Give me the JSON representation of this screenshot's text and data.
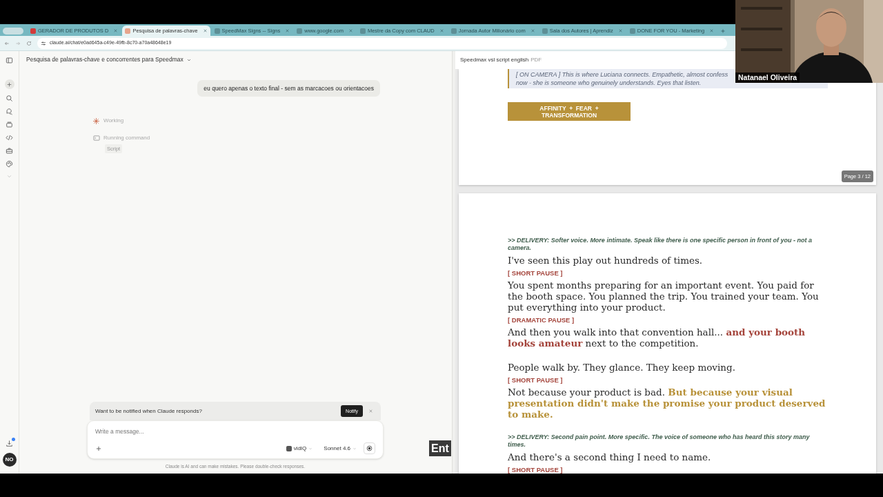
{
  "browser": {
    "tabs": [
      {
        "label": "GERADOR DE PRODUTOS D",
        "selected": false
      },
      {
        "label": "Pesquisa de palavras-chave",
        "selected": true
      },
      {
        "label": "SpeedMax Signs -- Signs",
        "selected": false
      },
      {
        "label": "www.google.com",
        "selected": false
      },
      {
        "label": "Mestre da Copy com CLAUD",
        "selected": false
      },
      {
        "label": "Jornada Autor Milionário com",
        "selected": false
      },
      {
        "label": "Sala dos Autores | Aprendiz",
        "selected": false
      },
      {
        "label": "DONE FOR YOU - Marketing",
        "selected": false
      }
    ],
    "address": "claude.ai/chat/e0ad645a-c49e-49fb-8c70-a70a48648e19"
  },
  "chat": {
    "title": "Pesquisa de palavras-chave e concorrentes para Speedmax",
    "user_message": "eu quero apenas o texto final - sem as marcacoes ou orientacoes",
    "status": "Working",
    "tool_step": {
      "label": "Running command",
      "badge": "Script"
    },
    "notification": {
      "text": "Want to be notified when Claude responds?",
      "button": "Notify"
    },
    "composer": {
      "placeholder": "Write a message...",
      "tool": "vidIQ",
      "model": "Sonnet 4.6"
    },
    "disclaimer": "Claude is AI and can make mistakes. Please double-check responses.",
    "avatar": "NO"
  },
  "document": {
    "title": "Speedmax vsl script english",
    "type": "PDF",
    "pages": [
      {
        "page_label": "Page 3 / 12",
        "blocks": [
          {
            "kind": "quote",
            "lines": [
              "[ ON CAMERA ] This is where Luciana connects. Empathetic, almost confess",
              "now - she is someone who genuinely understands. Eyes that listen."
            ]
          },
          {
            "kind": "banner",
            "text": "AFFINITY  +  FEAR  + TRANSFORMATION"
          }
        ]
      },
      {
        "blocks": [
          {
            "kind": "delivery",
            "text": ">> DELIVERY: Softer voice. More intimate. Speak like there is one specific person in front of you - not a camera."
          },
          {
            "kind": "line",
            "text": "I've seen this play out hundreds of times."
          },
          {
            "kind": "pause",
            "text": "[ SHORT PAUSE ]"
          },
          {
            "kind": "line",
            "text": "You spent months preparing for an important event. You paid for the booth space. You planned the trip. You trained your team. You put everything into your product."
          },
          {
            "kind": "pause",
            "text": "[ DRAMATIC PAUSE ]"
          },
          {
            "kind": "line",
            "text": "And then you walk into that convention hall... **and your booth looks amateur** next to the competition.",
            "color": "#a4443b"
          },
          {
            "kind": "line",
            "text": "People walk by. They glance. They keep moving.",
            "spaced": true
          },
          {
            "kind": "pause",
            "text": "[ SHORT PAUSE ]"
          },
          {
            "kind": "line",
            "text": "Not because your product is bad. **But because your visual presentation didn't make the promise your product deserved to make.**",
            "color": "#b8923a"
          },
          {
            "kind": "delivery",
            "text": ">> DELIVERY: Second pain point. More specific. The voice of someone who has heard this story many times.",
            "spaced": true
          },
          {
            "kind": "line",
            "text": "And there's a second thing I need to name."
          },
          {
            "kind": "pause",
            "text": "[ SHORT PAUSE ]"
          }
        ]
      }
    ]
  },
  "webcam": {
    "name": "Natanael Oliveira"
  },
  "caption": "Ent"
}
